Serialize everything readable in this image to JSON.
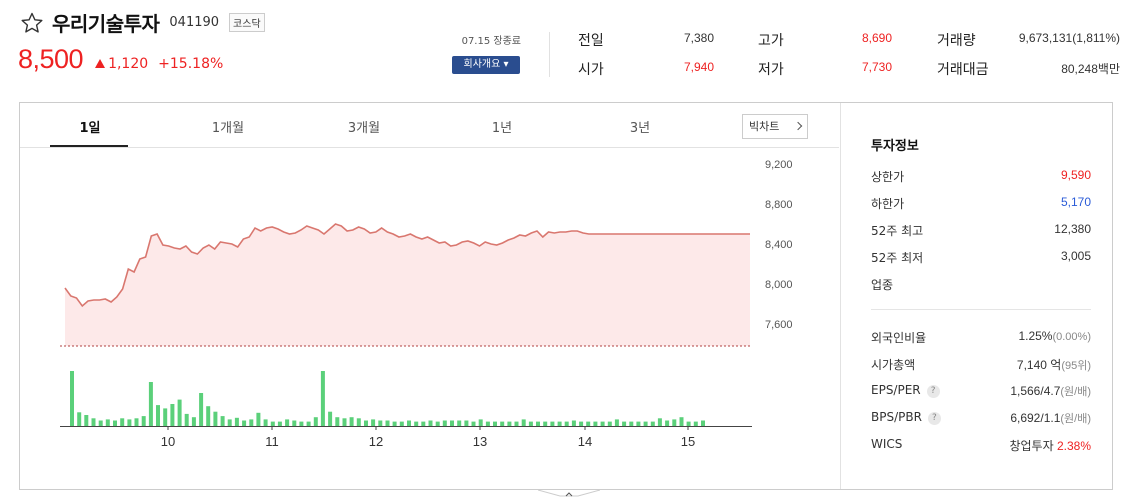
{
  "header": {
    "stock_name": "우리기술투자",
    "stock_code": "041190",
    "market": "코스닥",
    "price": "8,500",
    "change": "1,120",
    "change_pct": "+15.18%",
    "market_status": "07.15 장종료",
    "company_button": "회사개요 ▾"
  },
  "stats": {
    "prev_close_label": "전일",
    "prev_close": "7,380",
    "open_label": "시가",
    "open": "7,940",
    "high_label": "고가",
    "high": "8,690",
    "low_label": "저가",
    "low": "7,730",
    "volume_label": "거래량",
    "volume": "9,673,131(1,811%)",
    "amount_label": "거래대금",
    "amount": "80,248백만"
  },
  "tabs": [
    "1일",
    "1개월",
    "3개월",
    "1년",
    "3년"
  ],
  "big_chart_label": "빅차트",
  "side": {
    "title": "투자정보",
    "rows": [
      {
        "label": "상한가",
        "value": "9,590",
        "color": "red"
      },
      {
        "label": "하한가",
        "value": "5,170",
        "color": "blue"
      },
      {
        "label": "52주 최고",
        "value": "12,380",
        "color": ""
      },
      {
        "label": "52주 최저",
        "value": "3,005",
        "color": ""
      },
      {
        "label": "업종",
        "value": "",
        "color": ""
      }
    ],
    "foreign_label": "외국인비율",
    "foreign_value": "1.25%",
    "foreign_sub": "(0.00%)",
    "mcap_label": "시가총액",
    "mcap_value": "7,140 억",
    "mcap_sub": "(95위)",
    "eps_label": "EPS/PER",
    "eps_value": "1,566/4.7",
    "eps_sub": "(원/배)",
    "bps_label": "BPS/PBR",
    "bps_value": "6,692/1.1",
    "bps_sub": "(원/배)",
    "wics_label": "WICS",
    "wics_value": "창업투자",
    "wics_pct": "2.38%"
  },
  "chart_data": {
    "type": "area",
    "y_ticks": [
      "9,200",
      "8,800",
      "8,400",
      "8,000",
      "7,600"
    ],
    "ylim": [
      7400,
      9300
    ],
    "x_ticks": [
      "10",
      "11",
      "12",
      "13",
      "14",
      "15"
    ],
    "reference_line": 7380,
    "colors": {
      "line": "#d9776f",
      "fill": "#fde9e9",
      "volume": "#5bd07a",
      "ref": "#b04040"
    },
    "price": [
      7960,
      7880,
      7860,
      7780,
      7830,
      7840,
      7840,
      7850,
      7820,
      7870,
      7950,
      8150,
      8120,
      8250,
      8270,
      8480,
      8500,
      8390,
      8380,
      8360,
      8350,
      8380,
      8320,
      8300,
      8360,
      8390,
      8350,
      8420,
      8410,
      8400,
      8370,
      8450,
      8470,
      8560,
      8530,
      8560,
      8570,
      8550,
      8520,
      8500,
      8510,
      8540,
      8580,
      8560,
      8540,
      8500,
      8550,
      8600,
      8580,
      8530,
      8540,
      8570,
      8550,
      8510,
      8520,
      8560,
      8520,
      8500,
      8470,
      8480,
      8500,
      8470,
      8450,
      8470,
      8440,
      8410,
      8420,
      8380,
      8390,
      8420,
      8430,
      8410,
      8380,
      8420,
      8400,
      8390,
      8410,
      8440,
      8460,
      8490,
      8480,
      8510,
      8530,
      8470,
      8520,
      8510,
      8520,
      8520,
      8530,
      8530,
      8510,
      8500,
      8500,
      8500,
      8500,
      8500,
      8500,
      8500,
      8500,
      8500,
      8500,
      8500,
      8500,
      8500,
      8500,
      8500,
      8500,
      8500,
      8500,
      8500,
      8500,
      8500,
      8500,
      8500,
      8500,
      8500,
      8500,
      8500,
      8500,
      8500
    ],
    "volume": [
      100,
      25,
      20,
      14,
      10,
      12,
      10,
      14,
      12,
      14,
      18,
      80,
      38,
      32,
      40,
      48,
      22,
      16,
      60,
      36,
      26,
      18,
      12,
      15,
      10,
      12,
      24,
      12,
      8,
      8,
      12,
      10,
      8,
      8,
      16,
      100,
      26,
      16,
      14,
      16,
      14,
      10,
      12,
      10,
      10,
      8,
      8,
      10,
      8,
      8,
      10,
      8,
      10,
      10,
      10,
      10,
      8,
      12,
      8,
      8,
      8,
      8,
      8,
      12,
      8,
      8,
      8,
      8,
      8,
      8,
      10,
      8,
      8,
      8,
      8,
      8,
      12,
      8,
      8,
      8,
      8,
      8,
      14,
      10,
      12,
      16,
      8,
      8,
      10
    ]
  }
}
